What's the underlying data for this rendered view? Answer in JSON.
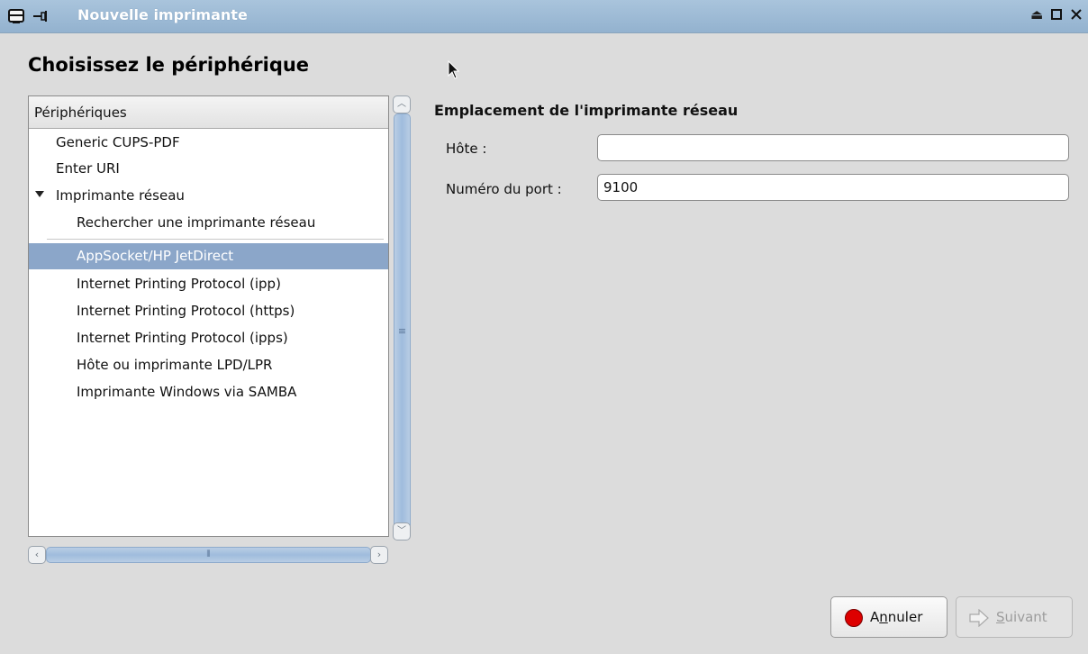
{
  "window": {
    "title": "Nouvelle imprimante"
  },
  "heading": "Choisissez le périphérique",
  "tree": {
    "header": "Périphériques",
    "rows": [
      {
        "label": "Generic CUPS-PDF",
        "indent": 0
      },
      {
        "label": "Enter URI",
        "indent": 0
      },
      {
        "label": "Imprimante réseau",
        "indent": 0,
        "expanded": true
      },
      {
        "label": "Rechercher une imprimante réseau",
        "indent": 1
      },
      {
        "label": "AppSocket/HP JetDirect",
        "indent": 1,
        "selected": true
      },
      {
        "label": "Internet Printing Protocol (ipp)",
        "indent": 1
      },
      {
        "label": "Internet Printing Protocol (https)",
        "indent": 1
      },
      {
        "label": "Internet Printing Protocol (ipps)",
        "indent": 1
      },
      {
        "label": "Hôte ou imprimante LPD/LPR",
        "indent": 1
      },
      {
        "label": "Imprimante Windows via SAMBA",
        "indent": 1
      }
    ]
  },
  "location": {
    "title": "Emplacement de l'imprimante réseau",
    "host_label": "Hôte :",
    "host_value": "",
    "port_label": "Numéro du port :",
    "port_value": "9100"
  },
  "buttons": {
    "cancel_pre": "A",
    "cancel_ul": "n",
    "cancel_post": "nuler",
    "next_ul": "S",
    "next_post": "uivant"
  },
  "icons": {
    "window": "printer-icon",
    "pin": "pin-icon",
    "eject": "eject-icon",
    "maximize": "maximize-icon",
    "close": "close-icon",
    "cancel": "stop-icon",
    "next": "arrow-right-icon"
  },
  "colors": {
    "selection": "#8ba6c9",
    "titlebar": "#a0bcd6"
  }
}
